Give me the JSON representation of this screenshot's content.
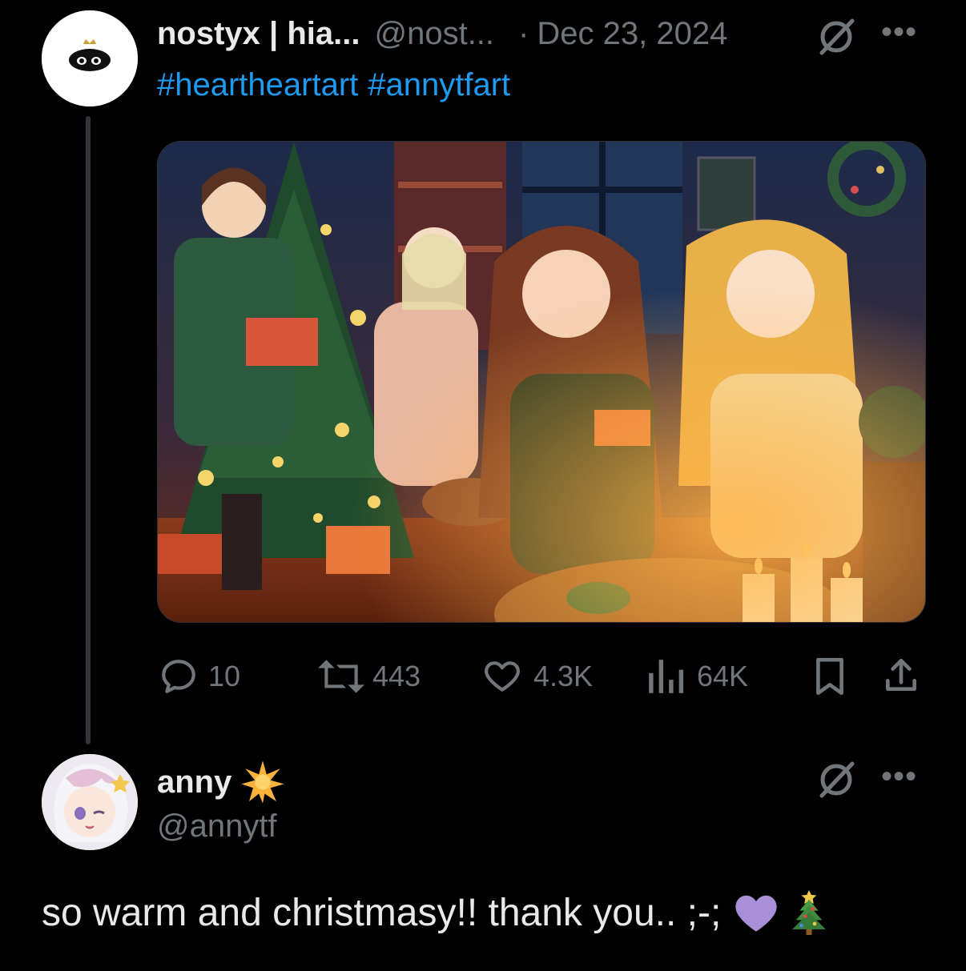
{
  "tweet": {
    "author_name": "nostyx | hia...",
    "handle": "@nost...",
    "separator": "·",
    "date": "Dec 23, 2024",
    "hashtags": [
      "#heartheartart",
      "#annytfart"
    ],
    "media_alt": "Christmas illustration of four characters by a decorated tree",
    "actions": {
      "replies": "10",
      "reposts": "443",
      "likes": "4.3K",
      "views": "64K"
    }
  },
  "reply": {
    "author_name": "anny",
    "handle": "@annytf",
    "text": "so warm and christmasy!! thank you.. ;-;",
    "emojis": [
      "purple-heart",
      "christmas-tree"
    ]
  },
  "colors": {
    "background": "#000000",
    "text": "#e7e9ea",
    "muted": "#71767b",
    "link": "#1d9bf0",
    "thread_line": "#333639",
    "purple_heart": "#a98fd8"
  }
}
